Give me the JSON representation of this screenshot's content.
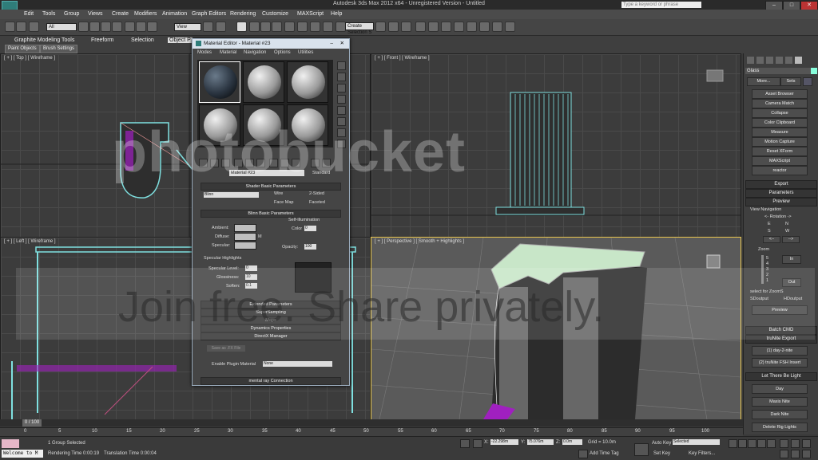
{
  "window": {
    "title": "Autodesk 3ds Max 2012 x64 - Unregistered Version - Untitled",
    "search_placeholder": "Type a keyword or phrase"
  },
  "menu": [
    "Edit",
    "Tools",
    "Group",
    "Views",
    "Create",
    "Modifiers",
    "Animation",
    "Graph Editors",
    "Rendering",
    "Customize",
    "MAXScript",
    "Help"
  ],
  "toolbar": {
    "selection_filter": "All",
    "reference_coord": "View",
    "selection_set": "Create Selection S"
  },
  "ribbon": {
    "tabs": [
      "Graphite Modeling Tools",
      "Freeform",
      "Selection",
      "Object P"
    ],
    "subtabs": [
      "Paint Objects",
      "Brush Settings"
    ]
  },
  "viewports": {
    "top": "[ + ] [ Top ] [ Wireframe ]",
    "front": "[ + ] [ Front ] [ Wireframe ]",
    "left": "[ + ] [ Left ] [ Wireframe ]",
    "perspective": "[ + ] [ Perspective ] [ Smooth + Highlights ]"
  },
  "material_editor": {
    "title": "Material Editor - Material #23",
    "menu": [
      "Modes",
      "Material",
      "Navigation",
      "Options",
      "Utilities"
    ],
    "material_name": "Material #23",
    "material_type": "Standard",
    "rollouts": {
      "shader_basic": "Shader Basic Parameters",
      "blinn_basic": "Blinn Basic Parameters",
      "extended": "Extended Parameters",
      "supersampling": "SuperSampling",
      "maps": "Maps",
      "dynamics": "Dynamics Properties",
      "directx": "DirectX Manager",
      "mental_ray": "mental ray Connection"
    },
    "shader": "Blinn",
    "checkboxes": [
      "Wire",
      "2-Sided",
      "Face Map",
      "Faceted"
    ],
    "self_illumination": "Self-Illumination",
    "color_label": "Color",
    "color_value": "0",
    "opacity_label": "Opacity:",
    "opacity_value": "100",
    "ambient": "Ambient:",
    "diffuse": "Diffuse:",
    "specular": "Specular:",
    "map_m": "M",
    "specular_highlights": "Specular Highlights",
    "specular_level": "Specular Level:",
    "specular_level_value": "0",
    "glossiness": "Glossiness:",
    "glossiness_value": "10",
    "soften": "Soften:",
    "soften_value": "0.1",
    "save_fx": "Save as .FX File",
    "enable_plugin": "Enable Plugin Material",
    "plugin_value": "None"
  },
  "command_panel": {
    "object_name": "Glass",
    "more": "More...",
    "sets": "Sets",
    "utilities": [
      "Asset Browser",
      "Camera Match",
      "Collapse",
      "Color Clipboard",
      "Measure",
      "Motion Capture",
      "Reset XForm",
      "MAXScript",
      "reactor"
    ],
    "rollouts": [
      "Export",
      "Parameters",
      "Preview"
    ],
    "view_navigation": "View Navigation",
    "rotation": "<- Rotation ->",
    "radio_e": "E",
    "radio_n": "N",
    "radio_s": "S",
    "radio_w": "W",
    "zoom": "Zoom",
    "zoom_levels": [
      "5",
      "4",
      "3",
      "2",
      "1"
    ],
    "in": "In",
    "out": "Out",
    "select_zoom": "select for ZoomS",
    "sd_output": "SDoutput",
    "hd_output": "HDoutput",
    "preview_btn": "Preview",
    "batch_cmd": "Batch CMD",
    "trunite_export": "truNite Export",
    "day_nite": "(1) day-2-nite",
    "fsh_insert": "(2) truNite FSH Insert",
    "let_there_be_light": "Let There Be Light",
    "light_buttons": [
      "Day",
      "Maxis Nite",
      "Dark Nite",
      "Delete Rig Lights"
    ]
  },
  "timeline": {
    "frame": "0 / 100",
    "ticks": [
      "0",
      "5",
      "10",
      "15",
      "20",
      "25",
      "30",
      "35",
      "40",
      "45",
      "50",
      "55",
      "60",
      "65",
      "70",
      "75",
      "80",
      "85",
      "90",
      "95",
      "100"
    ]
  },
  "status": {
    "listener": "Welcome to M",
    "selected": "1 Group Selected",
    "rendering_time": "Rendering Time  0:00:19",
    "translation_time": "Translation Time  0:00:04",
    "x_label": "X:",
    "x_value": "-22.298m",
    "y_label": "Y:",
    "y_value": "75.076m",
    "z_label": "Z:",
    "z_value": "0.0m",
    "grid": "Grid = 10.0m",
    "add_time_tag": "Add Time Tag",
    "auto_key": "Auto Key",
    "set_key": "Set Key",
    "selected_dd": "Selected",
    "key_filters": "Key Filters..."
  },
  "watermark": {
    "brand": "photobucket",
    "slogan": "Join free. Share privately."
  },
  "colors": {
    "active_border": "#e9c64e",
    "building_top": "#c8e6c8",
    "wire_cyan": "#7fe0e0",
    "magenta": "#a020c0"
  }
}
